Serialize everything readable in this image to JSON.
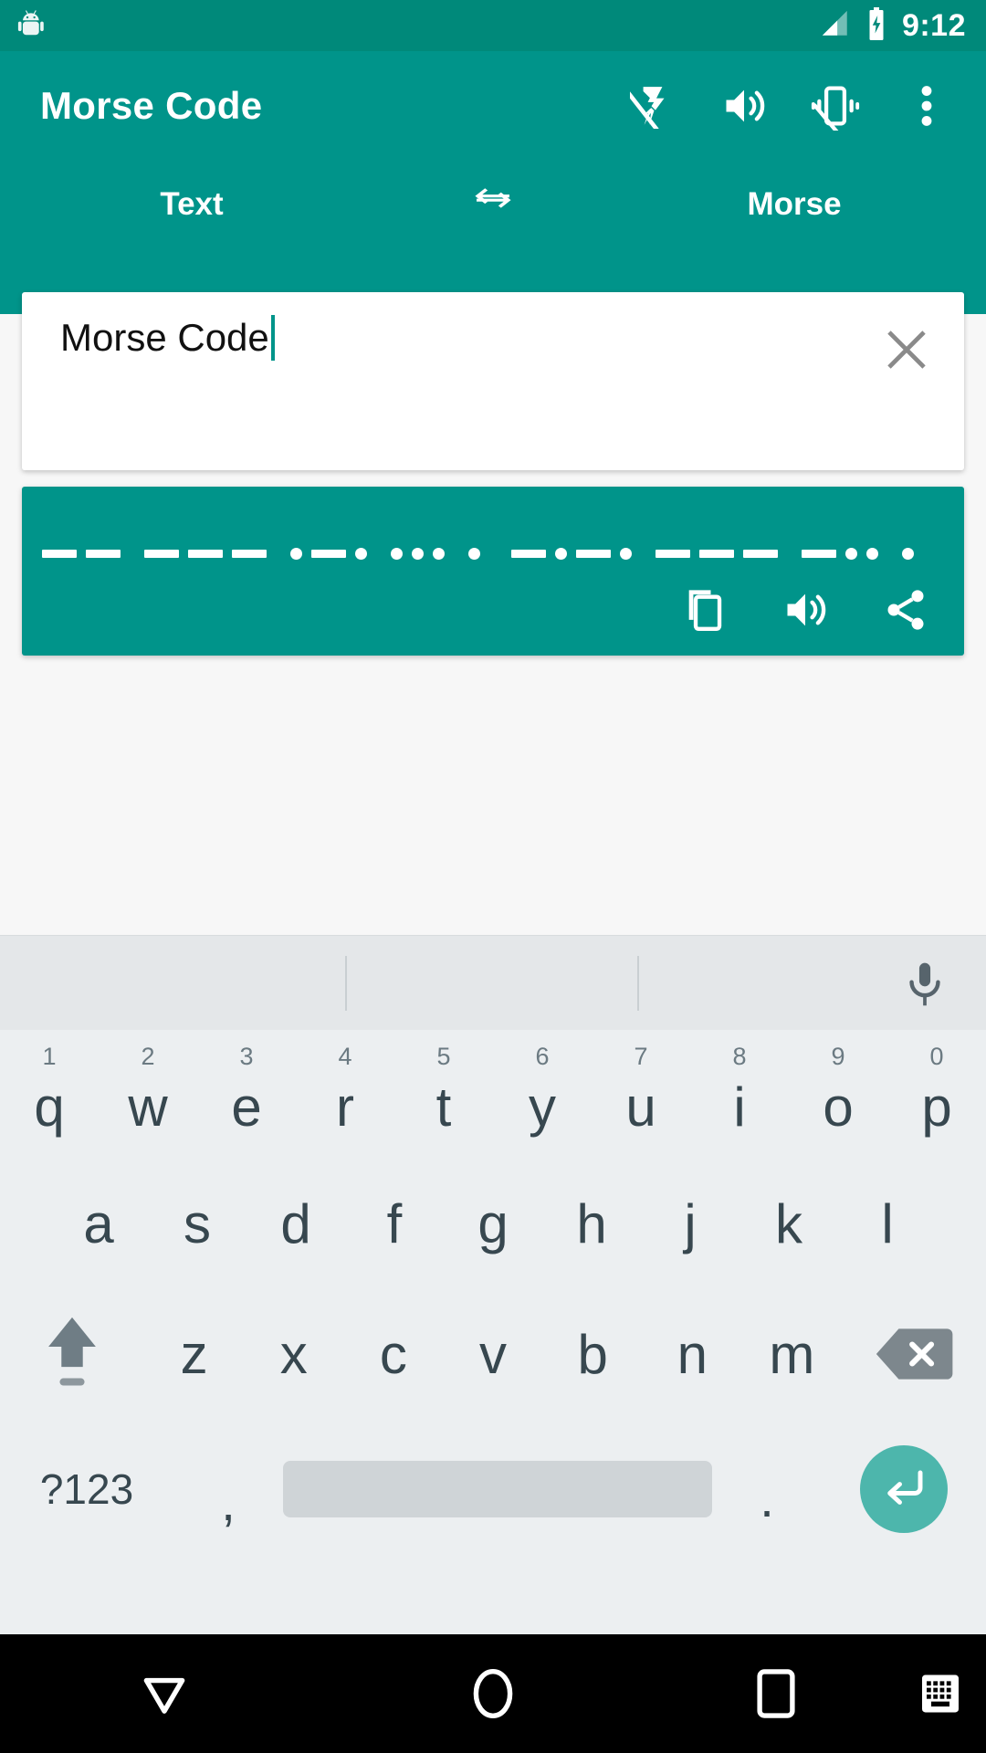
{
  "status_bar": {
    "time": "9:12",
    "icons": [
      "android-bugdroid-icon",
      "signal-icon",
      "battery-charging-icon"
    ],
    "background": "#00897a"
  },
  "app_bar": {
    "title": "Morse Code",
    "background": "#00948a",
    "actions": [
      {
        "name": "flash-off-icon",
        "label": "Flash off"
      },
      {
        "name": "volume-up-icon",
        "label": "Sound"
      },
      {
        "name": "vibration-off-icon",
        "label": "Vibration off"
      },
      {
        "name": "overflow-menu-icon",
        "label": "More options"
      }
    ]
  },
  "tabs": {
    "left_label": "Text",
    "swap_icon": "swap-horizontal-icon",
    "right_label": "Morse"
  },
  "input": {
    "value": "Morse Code",
    "placeholder": "",
    "clear_icon": "close-icon",
    "caret_color": "#00948a"
  },
  "output": {
    "morse": "-- --- .-. ... .  -.-. --- -.. .",
    "background": "#00948a",
    "words": [
      {
        "text": "MORSE",
        "letters": [
          {
            "char": "M",
            "code": "--"
          },
          {
            "char": "O",
            "code": "---"
          },
          {
            "char": "R",
            "code": ".-."
          },
          {
            "char": "S",
            "code": "..."
          },
          {
            "char": "E",
            "code": "."
          }
        ]
      },
      {
        "text": "CODE",
        "letters": [
          {
            "char": "C",
            "code": "-.-."
          },
          {
            "char": "O",
            "code": "---"
          },
          {
            "char": "D",
            "code": "-.."
          },
          {
            "char": "E",
            "code": "."
          }
        ]
      }
    ],
    "actions": [
      {
        "name": "copy-icon",
        "label": "Copy"
      },
      {
        "name": "volume-up-icon",
        "label": "Play"
      },
      {
        "name": "share-icon",
        "label": "Share"
      }
    ]
  },
  "keyboard": {
    "background": "#eceff1",
    "suggestion_strip": {
      "suggestions": [
        "",
        "",
        ""
      ],
      "mic_icon": "microphone-icon"
    },
    "row1": [
      {
        "letter": "q",
        "num": "1"
      },
      {
        "letter": "w",
        "num": "2"
      },
      {
        "letter": "e",
        "num": "3"
      },
      {
        "letter": "r",
        "num": "4"
      },
      {
        "letter": "t",
        "num": "5"
      },
      {
        "letter": "y",
        "num": "6"
      },
      {
        "letter": "u",
        "num": "7"
      },
      {
        "letter": "i",
        "num": "8"
      },
      {
        "letter": "o",
        "num": "9"
      },
      {
        "letter": "p",
        "num": "0"
      }
    ],
    "row2": [
      "a",
      "s",
      "d",
      "f",
      "g",
      "h",
      "j",
      "k",
      "l"
    ],
    "row3": {
      "shift_icon": "shift-arrow-icon",
      "letters": [
        "z",
        "x",
        "c",
        "v",
        "b",
        "n",
        "m"
      ],
      "backspace_icon": "backspace-icon"
    },
    "row4": {
      "symbols_label": "?123",
      "comma": ",",
      "space": "",
      "period": ".",
      "enter_icon": "enter-return-icon",
      "enter_color": "#4db6ac"
    }
  },
  "nav_bar": {
    "background": "#000000",
    "buttons": [
      {
        "name": "back-down-icon",
        "label": "Back"
      },
      {
        "name": "home-circle-icon",
        "label": "Home"
      },
      {
        "name": "recents-square-icon",
        "label": "Recents"
      },
      {
        "name": "keyboard-switcher-icon",
        "label": "Switch keyboard"
      }
    ]
  }
}
